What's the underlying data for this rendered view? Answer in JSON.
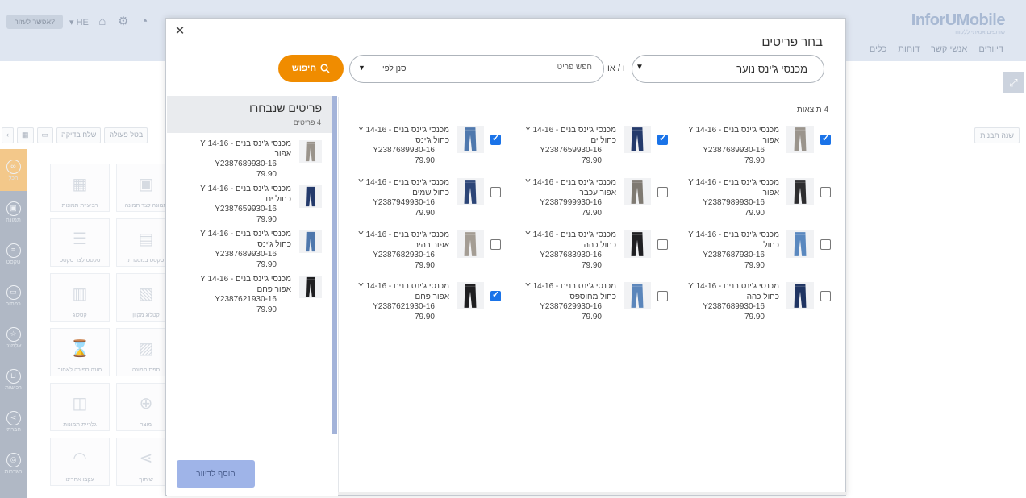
{
  "app": {
    "logo": "InforUMobile",
    "logo_sub": "שותפים אמיתי ללקוח",
    "help": "אפשר לעזור?",
    "lang": "HE",
    "nav": [
      "דיוורים",
      "אנשי קשר",
      "דוחות",
      "כלים"
    ],
    "template_btn": "שנה תבנית",
    "toolbar": {
      "send_test": "שלח בדיקה",
      "undo": "בטל פעולה"
    },
    "rail": [
      "הכל",
      "תמונה",
      "טקסט",
      "כפתור",
      "אלמנט",
      "רכישות",
      "חברתי",
      "הגדרות"
    ],
    "widgets": [
      "תמונה לצד תמונה",
      "רביעיית תמונות",
      "טקסט במסגרת",
      "טקסט לצד טקסט",
      "קטלוג מקוון",
      "קטלוג",
      "ספת תמונה",
      "מונה ספירה לאחור",
      "מוצר",
      "גלריית תמונות",
      "שיתוף",
      "עקבו אחרינו"
    ]
  },
  "modal": {
    "title": "בחר פריטים",
    "category_value": "מכנסי ג'ינס נוער",
    "or_label": "ו / או",
    "search_placeholder": "חפש פריט",
    "filter_label": "סנן לפי",
    "search_button": "חיפוש",
    "results_count": "4 תוצאות",
    "products": [
      {
        "name": "מכנסי ג'ינס בנים - 14-16 Y",
        "variant": "אפור",
        "sku": "Y2387689930-16",
        "price": "79.90",
        "checked": true,
        "color": "#9a948c"
      },
      {
        "name": "מכנסי ג'ינס בנים - 14-16 Y",
        "variant": "כחול ים",
        "sku": "Y2387659930-16",
        "price": "79.90",
        "checked": true,
        "color": "#243a6b"
      },
      {
        "name": "מכנסי ג'ינס בנים - 14-16 Y",
        "variant": "כחול ג'ינס",
        "sku": "Y2387689930-16",
        "price": "79.90",
        "checked": true,
        "color": "#4f78ad"
      },
      {
        "name": "מכנסי ג'ינס בנים - 14-16 Y",
        "variant": "אפור",
        "sku": "Y2387989930-16",
        "price": "79.90",
        "checked": false,
        "color": "#2d2d2f"
      },
      {
        "name": "מכנסי ג'ינס בנים - 14-16 Y",
        "variant": "אפור עכבר",
        "sku": "Y2387999930-16",
        "price": "79.90",
        "checked": false,
        "color": "#7f7a72"
      },
      {
        "name": "מכנסי ג'ינס בנים - 14-16 Y",
        "variant": "כחול שמים",
        "sku": "Y2387949930-16",
        "price": "79.90",
        "checked": false,
        "color": "#2c4577"
      },
      {
        "name": "מכנסי ג'ינס בנים - 14-16 Y",
        "variant": "כחול",
        "sku": "Y2387687930-16",
        "price": "79.90",
        "checked": false,
        "color": "#5a88bf"
      },
      {
        "name": "מכנסי ג'ינס בנים - 14-16 Y",
        "variant": "כחול כהה",
        "sku": "Y2387683930-16",
        "price": "79.90",
        "checked": false,
        "color": "#1f1f22"
      },
      {
        "name": "מכנסי ג'ינס בנים - 14-16 Y",
        "variant": "אפור בהיר",
        "sku": "Y2387682930-16",
        "price": "79.90",
        "checked": false,
        "color": "#a49d94"
      },
      {
        "name": "מכנסי ג'ינס בנים - 14-16 Y",
        "variant": "כחול כהה",
        "sku": "Y2387689930-16",
        "price": "79.90",
        "checked": false,
        "color": "#1f3462"
      },
      {
        "name": "מכנסי ג'ינס בנים - 14-16 Y",
        "variant": "כחול מחוספס",
        "sku": "Y2387629930-16",
        "price": "79.90",
        "checked": false,
        "color": "#5b86bb"
      },
      {
        "name": "מכנסי ג'ינס בנים - 14-16 Y",
        "variant": "אפור פחם",
        "sku": "Y2387621930-16",
        "price": "79.90",
        "checked": true,
        "color": "#1e1e20"
      }
    ],
    "selected": {
      "title": "פריטים שנבחרו",
      "count": "4 פריטים",
      "items": [
        {
          "name": "מכנסי ג'ינס בנים - 14-16 Y",
          "variant": "אפור",
          "sku": "Y2387689930-16",
          "price": "79.90",
          "color": "#9a948c"
        },
        {
          "name": "מכנסי ג'ינס בנים - 14-16 Y",
          "variant": "כחול ים",
          "sku": "Y2387659930-16",
          "price": "79.90",
          "color": "#243a6b"
        },
        {
          "name": "מכנסי ג'ינס בנים - 14-16 Y",
          "variant": "כחול ג'ינס",
          "sku": "Y2387689930-16",
          "price": "79.90",
          "color": "#4f78ad"
        },
        {
          "name": "מכנסי ג'ינס בנים - 14-16 Y",
          "variant": "אפור פחם",
          "sku": "Y2387621930-16",
          "price": "79.90",
          "color": "#1e1e20"
        }
      ]
    },
    "add_button": "הוסף לדיוור"
  }
}
